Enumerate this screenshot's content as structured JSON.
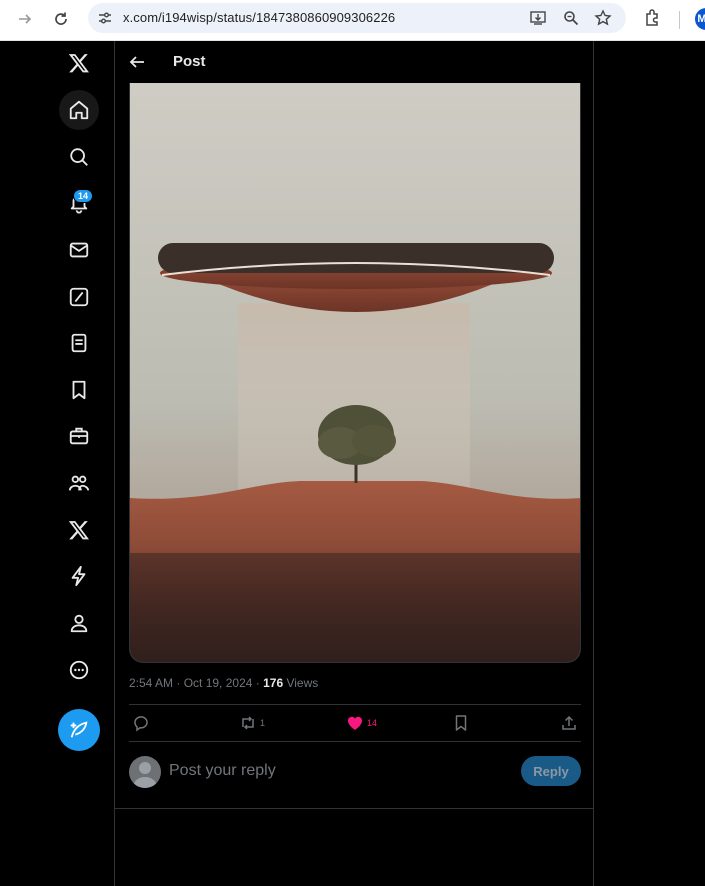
{
  "browser": {
    "url": "x.com/i194wisp/status/1847380860909306226",
    "profile_initial": "M"
  },
  "nav": {
    "notification_count": "14",
    "items": [
      "x-logo-icon",
      "home-icon",
      "search-icon",
      "bell-icon",
      "mail-icon",
      "grok-icon",
      "lists-icon",
      "bookmark-icon",
      "jobs-icon",
      "communities-icon",
      "premium-icon",
      "verified-orgs-icon",
      "profile-icon",
      "more-icon"
    ]
  },
  "header": {
    "title": "Post"
  },
  "post": {
    "time": "2:54 AM",
    "separator1": " · ",
    "date": "Oct 19, 2024",
    "separator2": " · ",
    "views_count": "176",
    "views_label": " Views",
    "retweet_count": "1",
    "like_count": "14",
    "like_color": "#f91880"
  },
  "reply": {
    "placeholder": "Post your reply",
    "button_label": "Reply"
  },
  "colors": {
    "accent": "#1d9bf0",
    "background": "#000000",
    "border": "#2f3336"
  }
}
